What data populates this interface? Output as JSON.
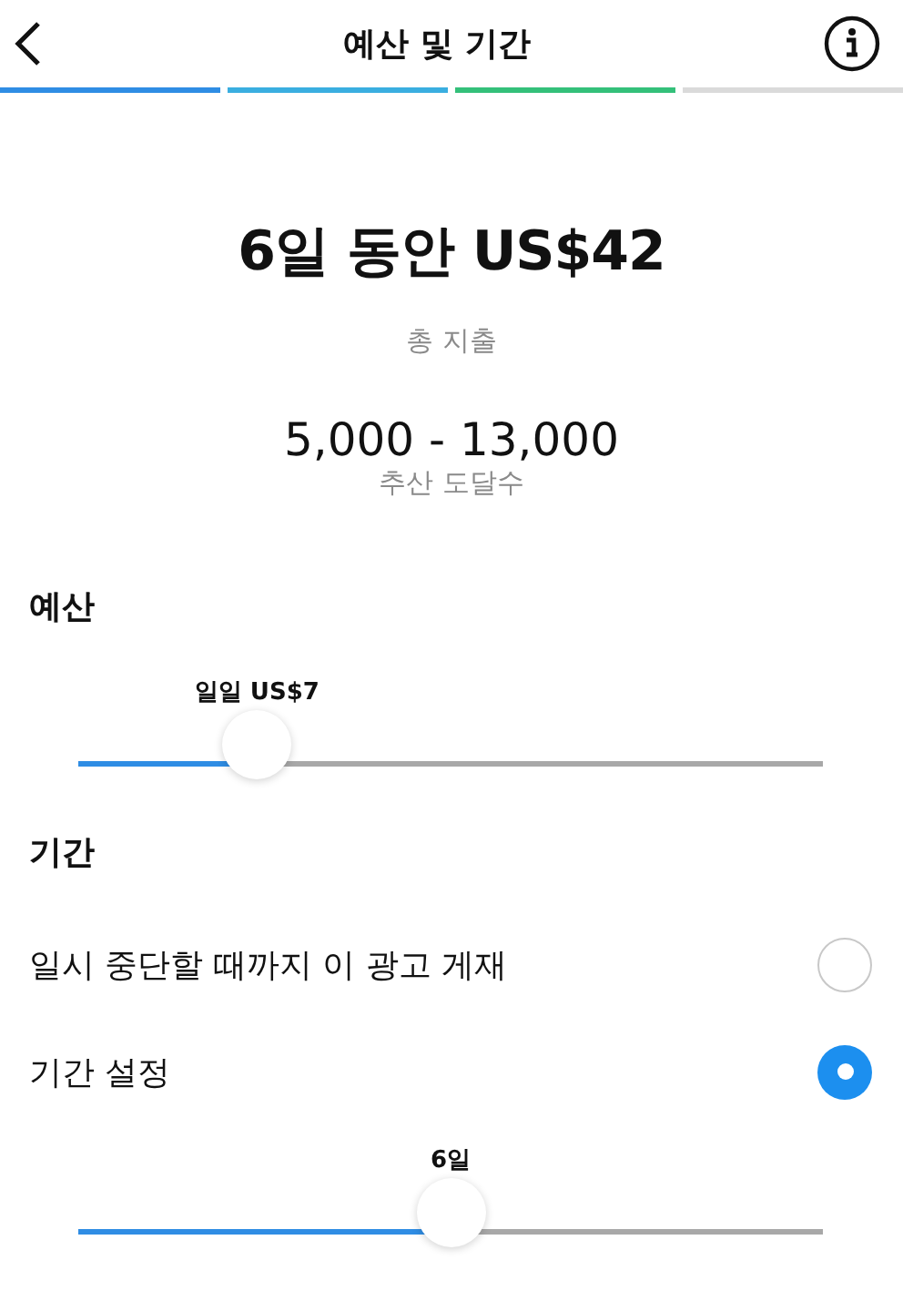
{
  "header": {
    "title": "예산 및 기간"
  },
  "steps": [
    {
      "color": "#2f8de4"
    },
    {
      "color": "#3aaee0"
    },
    {
      "color": "#34c07a"
    },
    {
      "color": "#dadada"
    }
  ],
  "summary": {
    "total": "6일 동안 US$42",
    "total_label": "총 지출",
    "reach": "5,000 - 13,000",
    "reach_label": "추산 도달수"
  },
  "budget": {
    "heading": "예산",
    "slider": {
      "label": "일일 US$7",
      "level": 0.24
    }
  },
  "duration": {
    "heading": "기간",
    "options": [
      {
        "label": "일시 중단할 때까지 이 광고 게재",
        "selected": false
      },
      {
        "label": "기간 설정",
        "selected": true
      }
    ],
    "slider": {
      "label": "6일",
      "level": 0.5
    }
  }
}
